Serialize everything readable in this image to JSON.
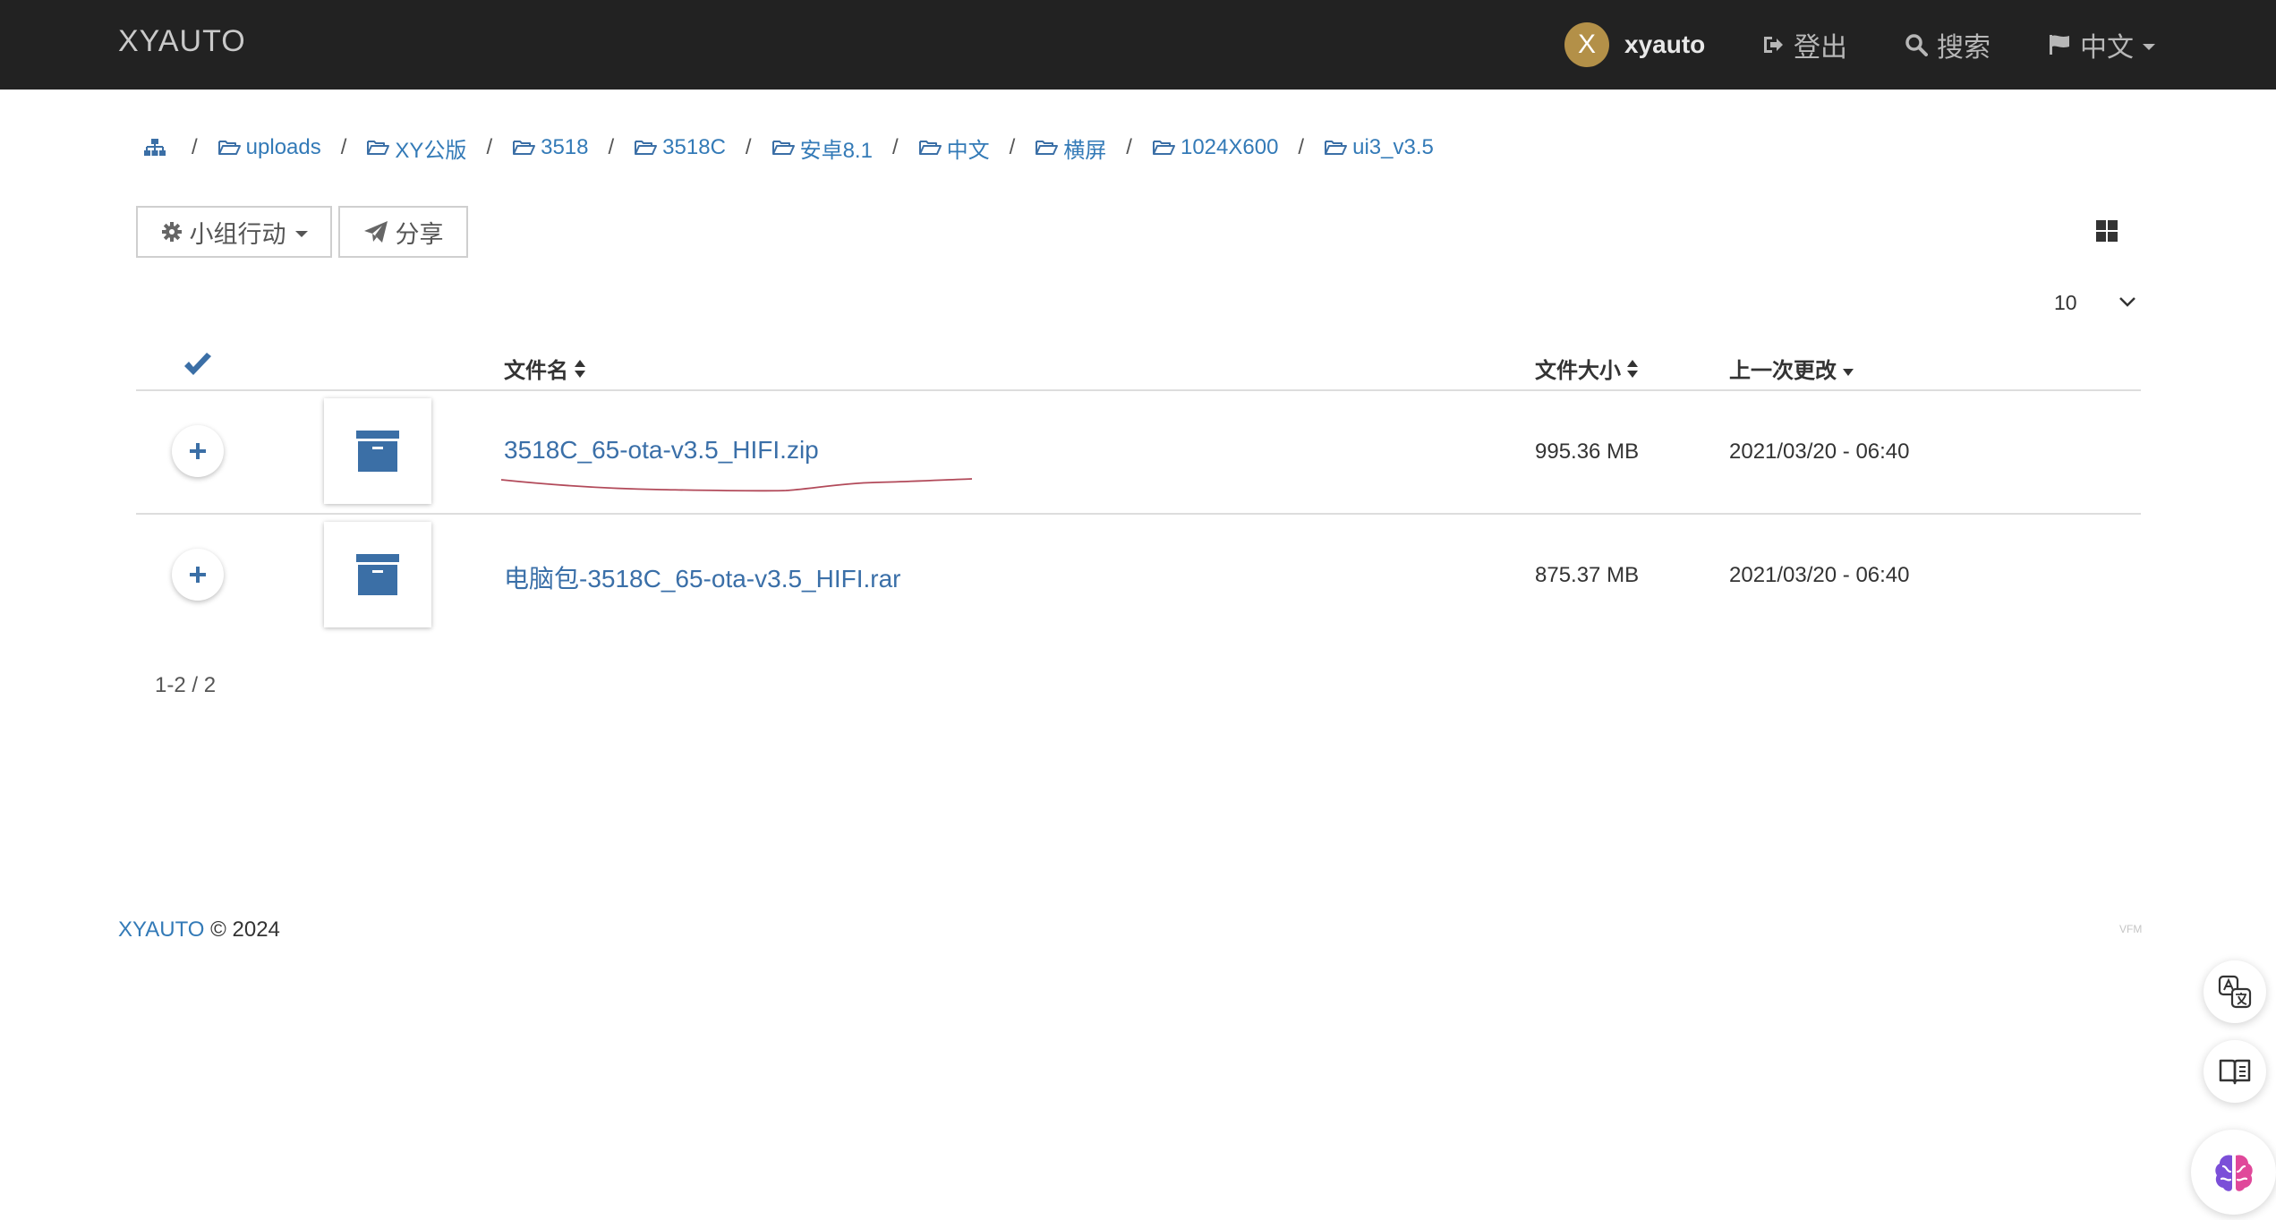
{
  "navbar": {
    "brand": "XYAUTO",
    "avatar_letter": "X",
    "username": "xyauto",
    "logout_label": "登出",
    "search_label": "搜索",
    "language_label": "中文"
  },
  "breadcrumb": {
    "items": [
      "uploads",
      "XY公版",
      "3518",
      "3518C",
      "安卓8.1",
      "中文",
      "横屏",
      "1024X600",
      "ui3_v3.5"
    ]
  },
  "toolbar": {
    "group_action_label": "小组行动",
    "share_label": "分享"
  },
  "per_page": {
    "value": "10"
  },
  "table": {
    "headers": {
      "name": "文件名",
      "size": "文件大小",
      "modified": "上一次更改"
    },
    "rows": [
      {
        "name": "3518C_65-ota-v3.5_HIFI.zip",
        "size": "995.36 MB",
        "modified": "2021/03/20 - 06:40"
      },
      {
        "name": "电脑包-3518C_65-ota-v3.5_HIFI.rar",
        "size": "875.37 MB",
        "modified": "2021/03/20 - 06:40"
      }
    ]
  },
  "pagination": {
    "count_text": "1-2 / 2"
  },
  "footer": {
    "brand": "XYAUTO",
    "copyright": "© 2024",
    "mark": "VFM"
  },
  "colors": {
    "navbar_bg": "#222222",
    "link": "#337ab7",
    "avatar": "#b39048",
    "icon_blue": "#3b6fa6"
  }
}
